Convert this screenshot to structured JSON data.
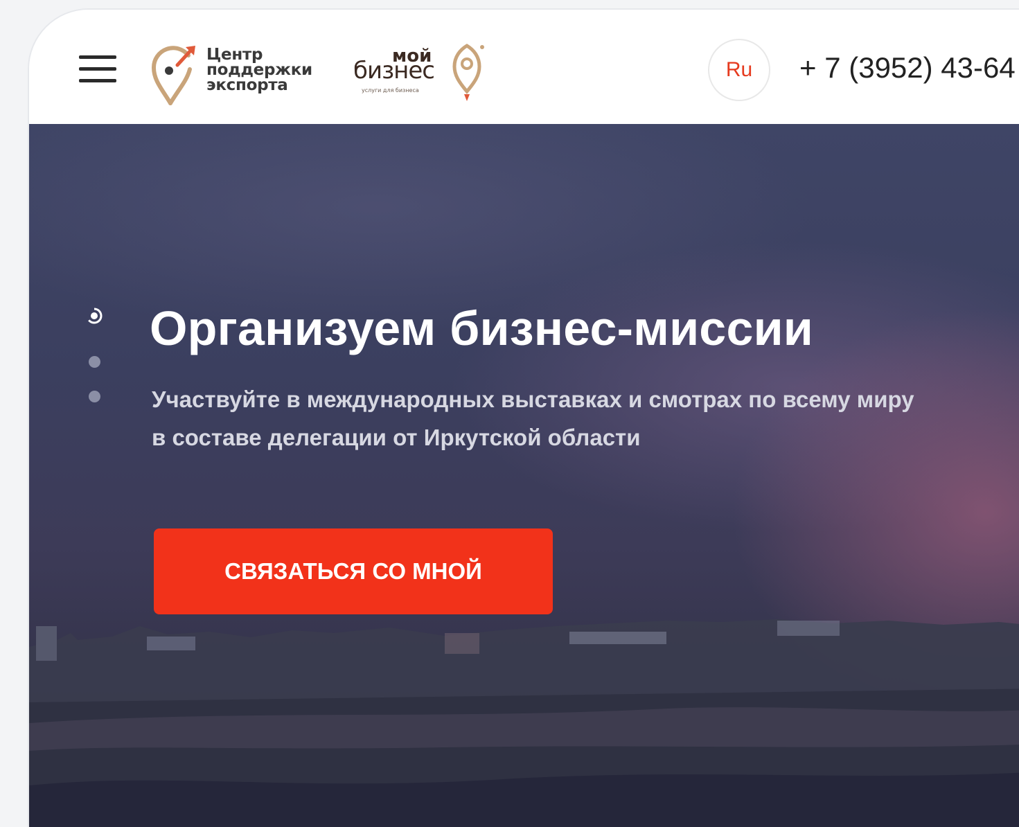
{
  "header": {
    "logo_cpe": {
      "line1": "Центр",
      "line2": "поддержки",
      "line3": "экспорта"
    },
    "logo_mb": {
      "moi": "мой",
      "biznes": "бизнес",
      "sub": "услуги для бизнеса"
    },
    "lang_label": "Ru",
    "phone": "+ 7 (3952) 43-64"
  },
  "hero": {
    "title": "Организуем бизнес-миссии",
    "subtitle_line1": "Участвуйте в международных выставках и смотрах по всему миру",
    "subtitle_line2": "в составе делегации от Иркутской области",
    "cta_label": "СВЯЗАТЬСЯ СО МНОЙ"
  },
  "colors": {
    "accent_red": "#f2321a",
    "logo_gold": "#c9a47a",
    "logo_arrow": "#e05a3a",
    "text_dark": "#222222"
  },
  "slider": {
    "total": 3,
    "active": 1
  }
}
